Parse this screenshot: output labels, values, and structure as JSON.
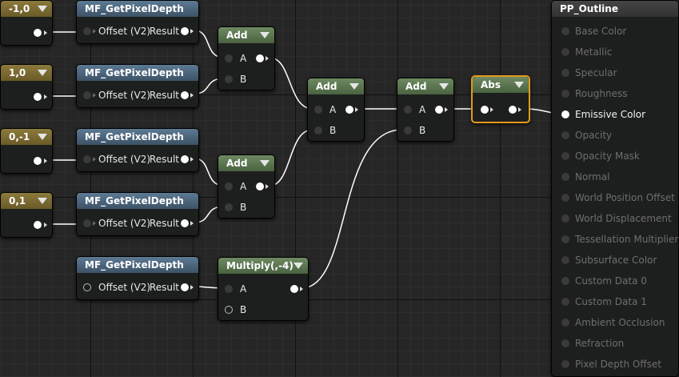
{
  "colors": {
    "constant_header": "#8c7a3c",
    "function_header": "#5d7a93",
    "math_header": "#6e8a62",
    "selection": "#e29a1b",
    "wire": "#ffffff"
  },
  "constants": [
    {
      "label": "-1,0"
    },
    {
      "label": "1,0"
    },
    {
      "label": "0,-1"
    },
    {
      "label": "0,1"
    }
  ],
  "functions": [
    {
      "title": "MF_GetPixelDepth",
      "input": "Offset (V2)",
      "output": "Result"
    },
    {
      "title": "MF_GetPixelDepth",
      "input": "Offset (V2)",
      "output": "Result"
    },
    {
      "title": "MF_GetPixelDepth",
      "input": "Offset (V2)",
      "output": "Result"
    },
    {
      "title": "MF_GetPixelDepth",
      "input": "Offset (V2)",
      "output": "Result"
    },
    {
      "title": "MF_GetPixelDepth",
      "input": "Offset (V2)",
      "output": "Result"
    }
  ],
  "math": {
    "add1": {
      "title": "Add",
      "a": "A",
      "b": "B"
    },
    "add2": {
      "title": "Add",
      "a": "A",
      "b": "B"
    },
    "add3": {
      "title": "Add",
      "a": "A",
      "b": "B"
    },
    "add4": {
      "title": "Add",
      "a": "A",
      "b": "B"
    },
    "multiply": {
      "title": "Multiply(,-4)",
      "a": "A",
      "b": "B"
    },
    "abs": {
      "title": "Abs"
    }
  },
  "result": {
    "title": "PP_Outline",
    "pins": [
      "Base Color",
      "Metallic",
      "Specular",
      "Roughness",
      "Emissive Color",
      "Opacity",
      "Opacity Mask",
      "Normal",
      "World Position Offset",
      "World Displacement",
      "Tessellation Multiplier",
      "Subsurface Color",
      "Custom Data 0",
      "Custom Data 1",
      "Ambient Occlusion",
      "Refraction",
      "Pixel Depth Offset"
    ],
    "active_pin": "Emissive Color"
  }
}
